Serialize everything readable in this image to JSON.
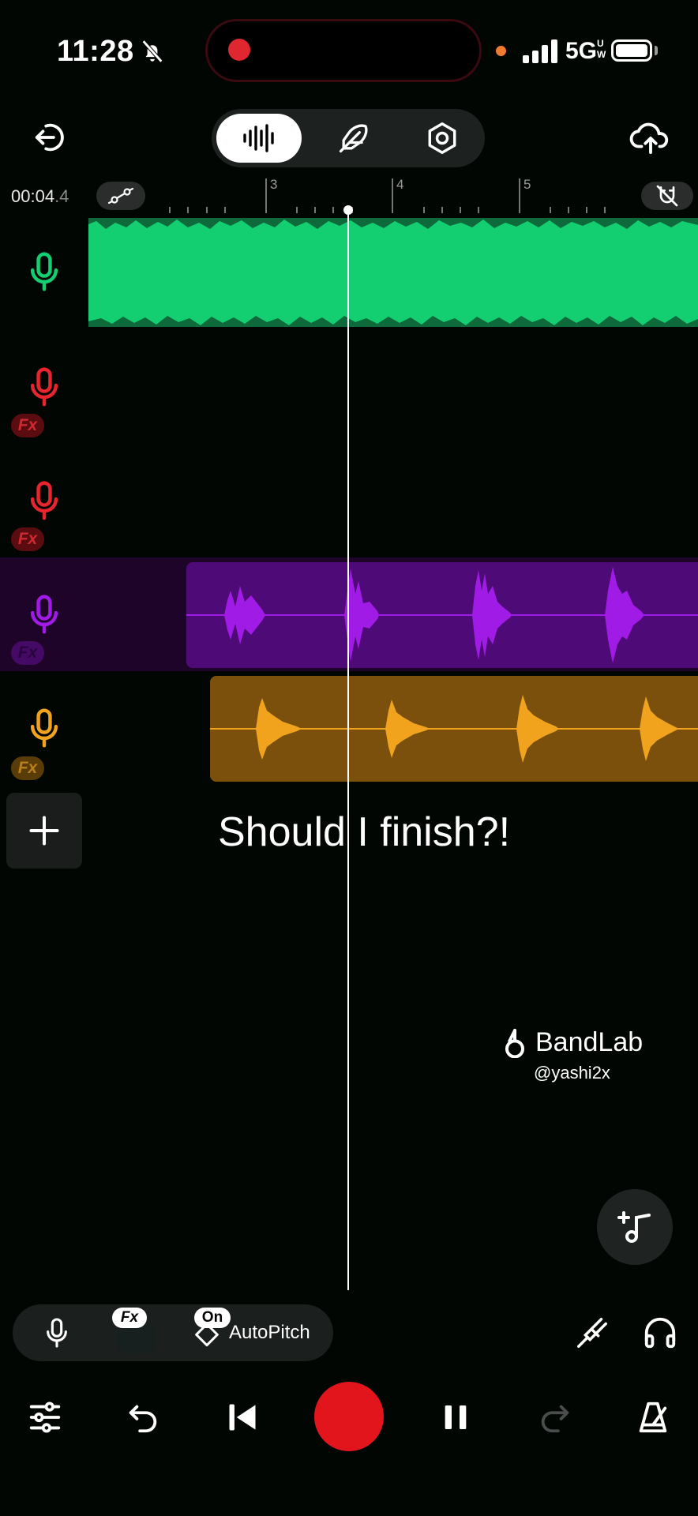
{
  "status_bar": {
    "time": "11:28",
    "network": "5G",
    "network_superscript": "UW",
    "icons": [
      "bell-slash-icon",
      "recording-dot-icon",
      "privacy-dot-icon",
      "signal-icon",
      "battery-icon"
    ]
  },
  "top_bar": {
    "exit_icon": "exit-icon",
    "modes": [
      {
        "name": "waveform",
        "icon": "waveform-icon",
        "active": true
      },
      {
        "name": "effects",
        "icon": "feather-icon",
        "active": false
      },
      {
        "name": "settings",
        "icon": "hex-nut-icon",
        "active": false
      }
    ],
    "upload_icon": "cloud-upload-icon"
  },
  "timeline": {
    "clock_main": "00:04",
    "clock_fraction": ".4",
    "ruler_labels": [
      "3",
      "4",
      "5"
    ],
    "automation_icon": "automation-icon",
    "snap_icon": "magnet-off-icon"
  },
  "tracks": [
    {
      "name": "track-1",
      "color": "#14cf72",
      "fx": false
    },
    {
      "name": "track-2",
      "color": "#e8242e",
      "fx": true,
      "fx_label": "Fx"
    },
    {
      "name": "track-3",
      "color": "#e8242e",
      "fx": true,
      "fx_label": "Fx"
    },
    {
      "name": "track-4",
      "color": "#a11be6",
      "fx": true,
      "fx_label": "Fx",
      "selected": true
    },
    {
      "name": "track-5",
      "color": "#f2a31d",
      "fx": true,
      "fx_label": "Fx"
    }
  ],
  "caption": "Should I finish?!",
  "watermark": {
    "brand": "BandLab",
    "handle": "@yashi2x"
  },
  "fab_icon": "add-instrument-icon",
  "bottom_bar": {
    "fx_label": "Fx",
    "on_label": "On",
    "autopitch_label": "AutoPitch",
    "icons": [
      "mic-icon",
      "tuning-fork-icon",
      "headphones-icon"
    ]
  },
  "transport": {
    "icons": [
      "mixer-icon",
      "undo-icon",
      "skip-back-icon",
      "record-icon",
      "pause-icon",
      "redo-icon",
      "metronome-icon"
    ]
  },
  "colors": {
    "background": "#020603",
    "green": "#14cf72",
    "red": "#e8242e",
    "purple": "#a11be6",
    "orange": "#f2a31d",
    "record": "#e2141c"
  }
}
